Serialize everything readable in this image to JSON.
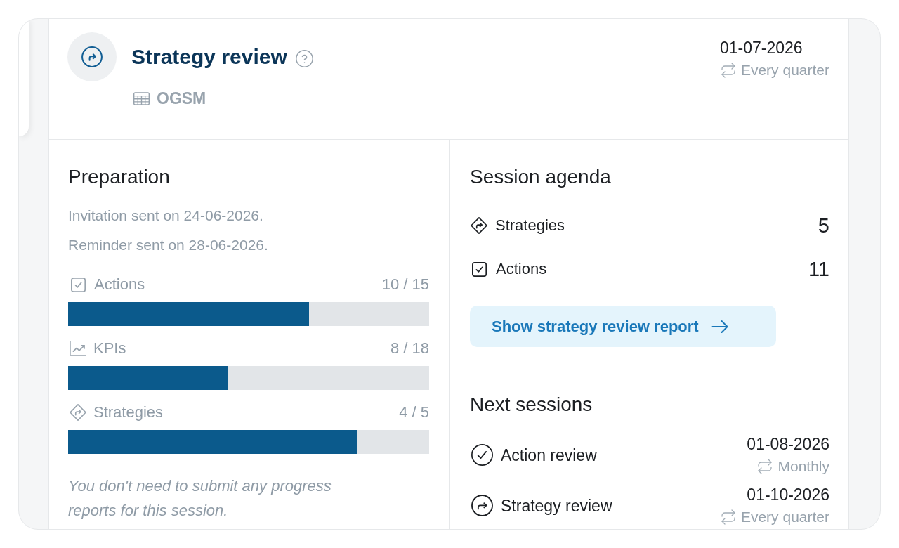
{
  "header": {
    "title": "Strategy review",
    "framework": "OGSM",
    "date": "01-07-2026",
    "recurrence": "Every quarter"
  },
  "preparation": {
    "title": "Preparation",
    "notes": [
      "Invitation sent on 24-06-2026.",
      "Reminder sent on 28-06-2026."
    ],
    "progress": [
      {
        "kind": "actions",
        "label": "Actions",
        "count": "10 / 15",
        "level": 0.667
      },
      {
        "kind": "kpis",
        "label": "KPIs",
        "count": "8 / 18",
        "level": 0.444
      },
      {
        "kind": "strategies",
        "label": "Strategies",
        "count": "4 / 5",
        "level": 0.8
      }
    ],
    "footnote": "You don't need to submit any progress reports for this session."
  },
  "agenda": {
    "title": "Session agenda",
    "items": [
      {
        "kind": "strategies",
        "label": "Strategies",
        "count": "5"
      },
      {
        "kind": "actions",
        "label": "Actions",
        "count": "11"
      }
    ],
    "button": "Show strategy review report"
  },
  "next_sessions": {
    "title": "Next sessions",
    "items": [
      {
        "kind": "action_review",
        "label": "Action review",
        "date": "01-08-2026",
        "recurrence": "Monthly"
      },
      {
        "kind": "strategy_review",
        "label": "Strategy review",
        "date": "01-10-2026",
        "recurrence": "Every quarter"
      }
    ]
  }
}
